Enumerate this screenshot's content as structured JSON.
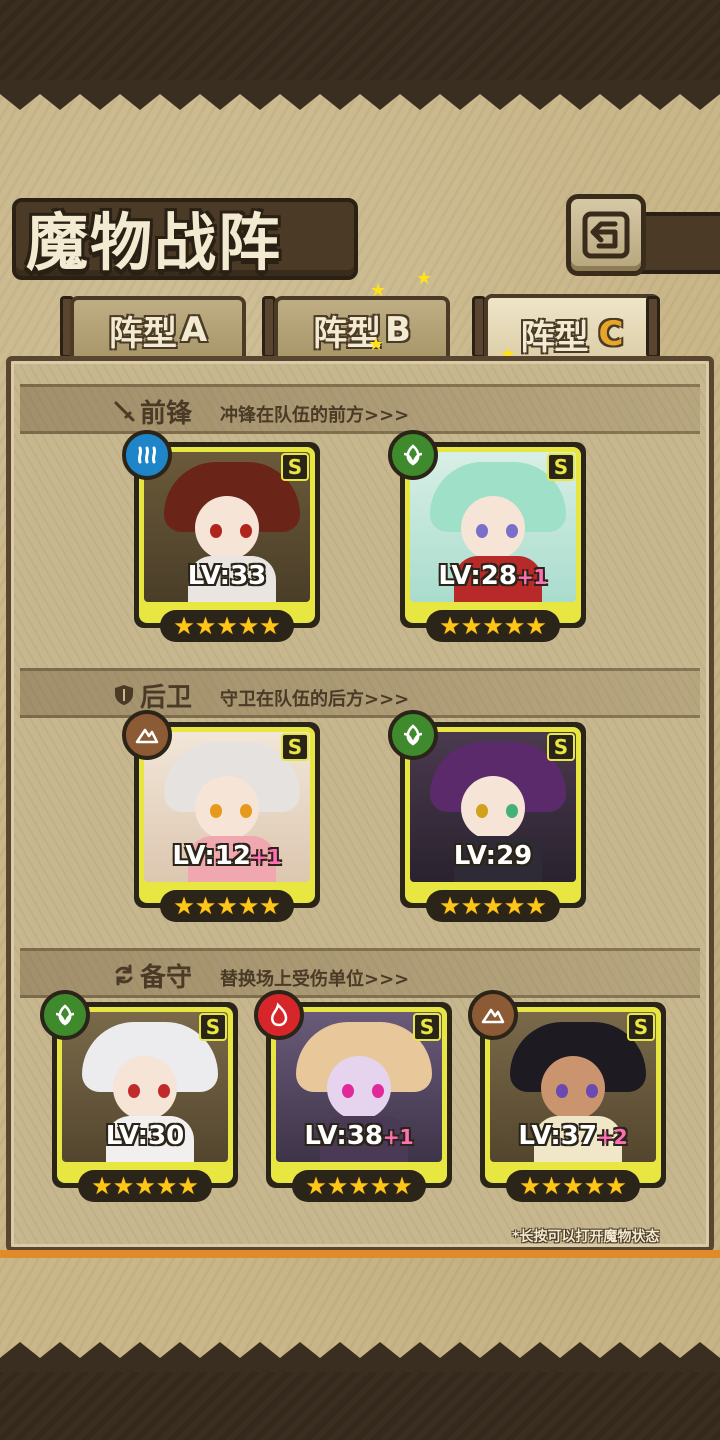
{
  "header": {
    "title": "魔物战阵",
    "back_icon": "back-arrow-icon"
  },
  "tabs": [
    {
      "label": "阵型",
      "letter": "A",
      "active": false
    },
    {
      "label": "阵型",
      "letter": "B",
      "active": false
    },
    {
      "label": "阵型",
      "letter": "C",
      "active": true
    }
  ],
  "sections": {
    "vanguard": {
      "title": "前锋",
      "desc": "冲锋在队伍的前方>>>",
      "icon": "sword-icon"
    },
    "rearguard": {
      "title": "后卫",
      "desc": "守卫在队伍的后方>>>",
      "icon": "shield-icon"
    },
    "reserve": {
      "title": "备守",
      "desc": "替换场上受伤单位>>>",
      "icon": "swap-icon"
    }
  },
  "monsters": [
    {
      "lv": "LV:33",
      "plus": "",
      "grade": "S",
      "element": "water",
      "stars": "★★★★★"
    },
    {
      "lv": "LV:28",
      "plus": "+1",
      "grade": "S",
      "element": "grass",
      "stars": "★★★★★"
    },
    {
      "lv": "LV:12",
      "plus": "+1",
      "grade": "S",
      "element": "earth",
      "stars": "★★★★★"
    },
    {
      "lv": "LV:29",
      "plus": "",
      "grade": "S",
      "element": "grass",
      "stars": "★★★★★"
    },
    {
      "lv": "LV:30",
      "plus": "",
      "grade": "S",
      "element": "grass",
      "stars": "★★★★★"
    },
    {
      "lv": "LV:38",
      "plus": "+1",
      "grade": "S",
      "element": "fire",
      "stars": "★★★★★"
    },
    {
      "lv": "LV:37",
      "plus": "+2",
      "grade": "S",
      "element": "earth",
      "stars": "★★★★★"
    }
  ],
  "footer_note": "*长按可以打开魔物状态",
  "colors": {
    "frame": "#e8e640",
    "star": "#ffc61a",
    "plus": "#ff6fb4",
    "tab_active_letter": "#e8a628",
    "water": "#1e86c8",
    "grass": "#3f8a2c",
    "earth": "#8d5a36",
    "fire": "#d6262a"
  }
}
